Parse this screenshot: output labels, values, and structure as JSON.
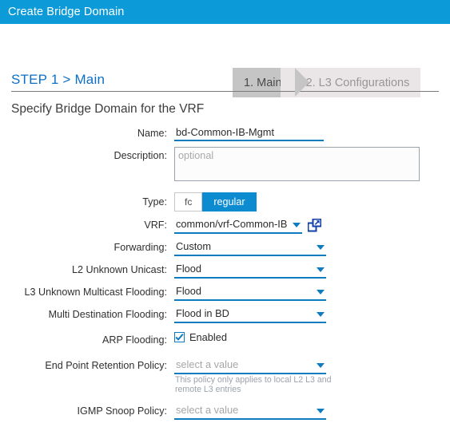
{
  "window": {
    "title": "Create Bridge Domain",
    "title_bar_color": "#0c9bd8"
  },
  "step_header": {
    "step_label": "STEP 1 > Main",
    "steps": [
      {
        "label": "1. Main",
        "state": "active"
      },
      {
        "label": "2. L3 Configurations",
        "state": "inactive"
      }
    ],
    "active_bg": "#c6c5c5",
    "inactive_bg": "#eae6e7"
  },
  "section": {
    "heading": "Specify Bridge Domain for the VRF"
  },
  "form": {
    "name": {
      "label": "Name:",
      "value": "bd-Common-IB-Mgmt",
      "placeholder": ""
    },
    "description": {
      "label": "Description:",
      "value": "",
      "placeholder": "optional"
    },
    "type": {
      "label": "Type:",
      "options": [
        "fc",
        "regular"
      ],
      "selected": "regular"
    },
    "vrf": {
      "label": "VRF:",
      "value": "common/vrf-Common-IB",
      "launch_icon": "open-in-new-window-icon"
    },
    "forwarding": {
      "label": "Forwarding:",
      "value": "Custom"
    },
    "l2_unknown_unicast": {
      "label": "L2 Unknown Unicast:",
      "value": "Flood"
    },
    "l3_unknown_multicast_flooding": {
      "label": "L3 Unknown Multicast Flooding:",
      "value": "Flood"
    },
    "multi_destination_flooding": {
      "label": "Multi Destination Flooding:",
      "value": "Flood in BD"
    },
    "arp_flooding": {
      "label": "ARP Flooding:",
      "checkbox_label": "Enabled",
      "checked": true
    },
    "end_point_retention_policy": {
      "label": "End Point Retention Policy:",
      "value": "select a value",
      "helper": "This policy only applies to local L2 L3 and remote L3 entries"
    },
    "igmp_snoop_policy": {
      "label": "IGMP Snoop Policy:",
      "value": "select a value"
    }
  },
  "colors": {
    "accent_blue": "#0c7bc0",
    "header_blue": "#0c9bd8",
    "toggle_on": "#0c8bd0",
    "link_blue": "#0d6fc4",
    "placeholder_gray": "#a6a6a6"
  }
}
